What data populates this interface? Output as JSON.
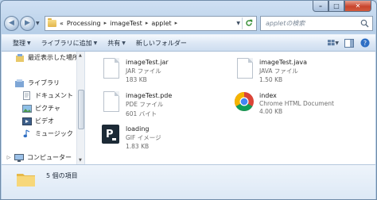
{
  "window": {
    "caption": {
      "minimize": "–",
      "maximize": "□",
      "close": "✕"
    }
  },
  "address": {
    "prefix": "«",
    "crumbs": [
      "Processing",
      "imageTest",
      "applet"
    ],
    "separator": "▸"
  },
  "search": {
    "placeholder": "appletの検索"
  },
  "toolbar": {
    "organize": "整理",
    "add_to_library": "ライブラリに追加",
    "share": "共有",
    "new_folder": "新しいフォルダー"
  },
  "nav": {
    "recent": "最近表示した場所",
    "library": "ライブラリ",
    "documents": "ドキュメント",
    "pictures": "ピクチャ",
    "videos": "ビデオ",
    "music": "ミュージック",
    "computer": "コンピューター"
  },
  "files": [
    {
      "name": "imageTest.jar",
      "type": "JAR ファイル",
      "size": "183 KB",
      "icon": "document-icon"
    },
    {
      "name": "imageTest.java",
      "type": "JAVA ファイル",
      "size": "1.50 KB",
      "icon": "document-icon"
    },
    {
      "name": "imageTest.pde",
      "type": "PDE ファイル",
      "size": "601 バイト",
      "icon": "document-icon"
    },
    {
      "name": "index",
      "type": "Chrome HTML Document",
      "size": "4.00 KB",
      "icon": "chrome-icon"
    },
    {
      "name": "loading",
      "type": "GIF イメージ",
      "size": "1.83 KB",
      "icon": "processing-icon"
    }
  ],
  "status": {
    "item_count": "5 個の項目"
  },
  "colors": {
    "accent": "#b9d1ea",
    "close": "#c8452d"
  }
}
